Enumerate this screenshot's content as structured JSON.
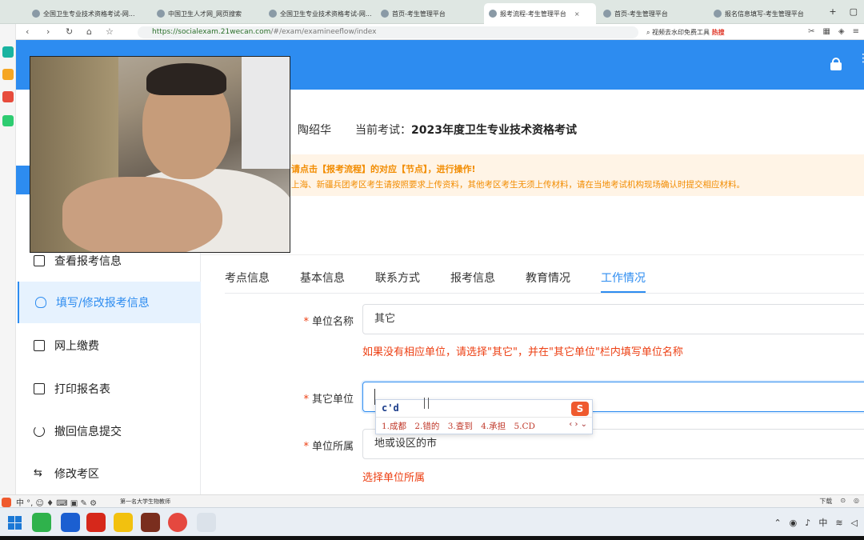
{
  "browser": {
    "tabs": [
      {
        "title": "全国卫生专业技术资格考试-网..."
      },
      {
        "title": "中国卫生人才网_网页搜索"
      },
      {
        "title": "全国卫生专业技术资格考试-网..."
      },
      {
        "title": "首页-考生管理平台"
      },
      {
        "title": "报考流程-考生管理平台"
      },
      {
        "title": "首页-考生管理平台"
      },
      {
        "title": "报名信息填写-考生管理平台"
      }
    ],
    "url_host": "https://socialexam.21wecan.com",
    "url_path": "/#/exam/examineeflow/index",
    "search_text": "视频去水印免费工具",
    "search_badge": "热搜",
    "new_tab": "+"
  },
  "header": {
    "lock_icon": "lock-icon"
  },
  "sidebar": {
    "items": [
      {
        "label": "查看报考信息",
        "icon": "document-icon",
        "active": false
      },
      {
        "label": "填写/修改报考信息",
        "icon": "shield-check-icon",
        "active": true
      },
      {
        "label": "网上缴费",
        "icon": "document-icon",
        "active": false
      },
      {
        "label": "打印报名表",
        "icon": "print-form-icon",
        "active": false
      },
      {
        "label": "撤回信息提交",
        "icon": "undo-icon",
        "active": false
      },
      {
        "label": "修改考区",
        "icon": "swap-icon",
        "active": false
      }
    ]
  },
  "info": {
    "name": "陶绍华",
    "exam_label": "当前考试：",
    "exam_name": "2023年度卫生专业技术资格考试"
  },
  "notice": {
    "line1": "请点击【报考流程】的对应【节点】，进行操作!",
    "line2": "上海、新疆兵团考区考生请按照要求上传资料，其他考区考生无须上传材料，请在当地考试机构现场确认时提交相应材料。"
  },
  "form_tabs": [
    {
      "label": "考点信息",
      "active": false
    },
    {
      "label": "基本信息",
      "active": false
    },
    {
      "label": "联系方式",
      "active": false
    },
    {
      "label": "报考信息",
      "active": false
    },
    {
      "label": "教育情况",
      "active": false
    },
    {
      "label": "工作情况",
      "active": true
    }
  ],
  "form": {
    "unit_name": {
      "label": "单位名称",
      "value": "其它",
      "hint": "如果没有相应单位，请选择\"其它\"，并在\"其它单位\"栏内填写单位名称"
    },
    "other_unit": {
      "label": "其它单位",
      "value": ""
    },
    "unit_location": {
      "label": "单位所属",
      "value": "地或设区的市",
      "hint": "选择单位所属"
    }
  },
  "ime": {
    "composition": "c'd",
    "candidates": [
      "1.成都",
      "2.错的",
      "3.查到",
      "4.承担",
      "5.CD"
    ],
    "logo": "S",
    "nav": "‹ › ⌄"
  },
  "statusbar": {
    "ime_tools": "中 °, ☺ ♦ ⌨ ▣ ✎ ⚙",
    "news": "第一名大学生物教师",
    "right": [
      "下载",
      "⊙",
      "◎"
    ]
  },
  "taskbar": {
    "tray_text": "中"
  },
  "colors": {
    "brand_blue": "#2d8cf0",
    "error_red": "#ed4014",
    "notice_orange": "#f28c00"
  }
}
